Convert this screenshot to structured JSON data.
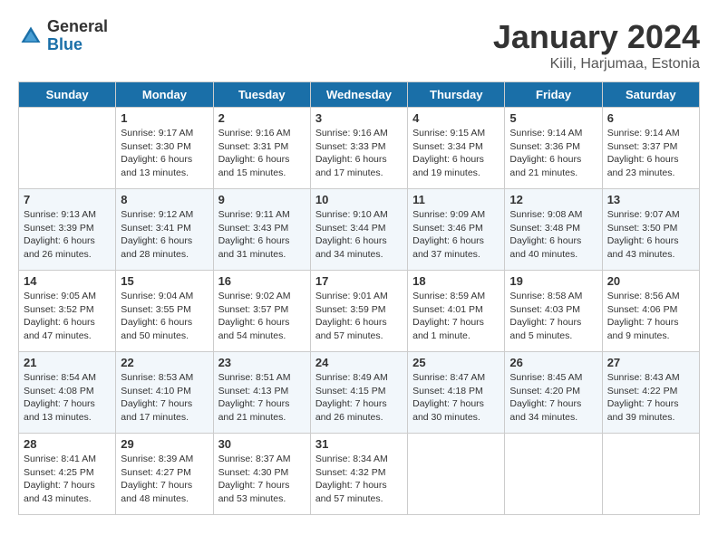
{
  "header": {
    "logo_general": "General",
    "logo_blue": "Blue",
    "title": "January 2024",
    "subtitle": "Kiili, Harjumaa, Estonia"
  },
  "days_of_week": [
    "Sunday",
    "Monday",
    "Tuesday",
    "Wednesday",
    "Thursday",
    "Friday",
    "Saturday"
  ],
  "weeks": [
    [
      {
        "date": "",
        "info": ""
      },
      {
        "date": "1",
        "info": "Sunrise: 9:17 AM\nSunset: 3:30 PM\nDaylight: 6 hours\nand 13 minutes."
      },
      {
        "date": "2",
        "info": "Sunrise: 9:16 AM\nSunset: 3:31 PM\nDaylight: 6 hours\nand 15 minutes."
      },
      {
        "date": "3",
        "info": "Sunrise: 9:16 AM\nSunset: 3:33 PM\nDaylight: 6 hours\nand 17 minutes."
      },
      {
        "date": "4",
        "info": "Sunrise: 9:15 AM\nSunset: 3:34 PM\nDaylight: 6 hours\nand 19 minutes."
      },
      {
        "date": "5",
        "info": "Sunrise: 9:14 AM\nSunset: 3:36 PM\nDaylight: 6 hours\nand 21 minutes."
      },
      {
        "date": "6",
        "info": "Sunrise: 9:14 AM\nSunset: 3:37 PM\nDaylight: 6 hours\nand 23 minutes."
      }
    ],
    [
      {
        "date": "7",
        "info": "Sunrise: 9:13 AM\nSunset: 3:39 PM\nDaylight: 6 hours\nand 26 minutes."
      },
      {
        "date": "8",
        "info": "Sunrise: 9:12 AM\nSunset: 3:41 PM\nDaylight: 6 hours\nand 28 minutes."
      },
      {
        "date": "9",
        "info": "Sunrise: 9:11 AM\nSunset: 3:43 PM\nDaylight: 6 hours\nand 31 minutes."
      },
      {
        "date": "10",
        "info": "Sunrise: 9:10 AM\nSunset: 3:44 PM\nDaylight: 6 hours\nand 34 minutes."
      },
      {
        "date": "11",
        "info": "Sunrise: 9:09 AM\nSunset: 3:46 PM\nDaylight: 6 hours\nand 37 minutes."
      },
      {
        "date": "12",
        "info": "Sunrise: 9:08 AM\nSunset: 3:48 PM\nDaylight: 6 hours\nand 40 minutes."
      },
      {
        "date": "13",
        "info": "Sunrise: 9:07 AM\nSunset: 3:50 PM\nDaylight: 6 hours\nand 43 minutes."
      }
    ],
    [
      {
        "date": "14",
        "info": "Sunrise: 9:05 AM\nSunset: 3:52 PM\nDaylight: 6 hours\nand 47 minutes."
      },
      {
        "date": "15",
        "info": "Sunrise: 9:04 AM\nSunset: 3:55 PM\nDaylight: 6 hours\nand 50 minutes."
      },
      {
        "date": "16",
        "info": "Sunrise: 9:02 AM\nSunset: 3:57 PM\nDaylight: 6 hours\nand 54 minutes."
      },
      {
        "date": "17",
        "info": "Sunrise: 9:01 AM\nSunset: 3:59 PM\nDaylight: 6 hours\nand 57 minutes."
      },
      {
        "date": "18",
        "info": "Sunrise: 8:59 AM\nSunset: 4:01 PM\nDaylight: 7 hours\nand 1 minute."
      },
      {
        "date": "19",
        "info": "Sunrise: 8:58 AM\nSunset: 4:03 PM\nDaylight: 7 hours\nand 5 minutes."
      },
      {
        "date": "20",
        "info": "Sunrise: 8:56 AM\nSunset: 4:06 PM\nDaylight: 7 hours\nand 9 minutes."
      }
    ],
    [
      {
        "date": "21",
        "info": "Sunrise: 8:54 AM\nSunset: 4:08 PM\nDaylight: 7 hours\nand 13 minutes."
      },
      {
        "date": "22",
        "info": "Sunrise: 8:53 AM\nSunset: 4:10 PM\nDaylight: 7 hours\nand 17 minutes."
      },
      {
        "date": "23",
        "info": "Sunrise: 8:51 AM\nSunset: 4:13 PM\nDaylight: 7 hours\nand 21 minutes."
      },
      {
        "date": "24",
        "info": "Sunrise: 8:49 AM\nSunset: 4:15 PM\nDaylight: 7 hours\nand 26 minutes."
      },
      {
        "date": "25",
        "info": "Sunrise: 8:47 AM\nSunset: 4:18 PM\nDaylight: 7 hours\nand 30 minutes."
      },
      {
        "date": "26",
        "info": "Sunrise: 8:45 AM\nSunset: 4:20 PM\nDaylight: 7 hours\nand 34 minutes."
      },
      {
        "date": "27",
        "info": "Sunrise: 8:43 AM\nSunset: 4:22 PM\nDaylight: 7 hours\nand 39 minutes."
      }
    ],
    [
      {
        "date": "28",
        "info": "Sunrise: 8:41 AM\nSunset: 4:25 PM\nDaylight: 7 hours\nand 43 minutes."
      },
      {
        "date": "29",
        "info": "Sunrise: 8:39 AM\nSunset: 4:27 PM\nDaylight: 7 hours\nand 48 minutes."
      },
      {
        "date": "30",
        "info": "Sunrise: 8:37 AM\nSunset: 4:30 PM\nDaylight: 7 hours\nand 53 minutes."
      },
      {
        "date": "31",
        "info": "Sunrise: 8:34 AM\nSunset: 4:32 PM\nDaylight: 7 hours\nand 57 minutes."
      },
      {
        "date": "",
        "info": ""
      },
      {
        "date": "",
        "info": ""
      },
      {
        "date": "",
        "info": ""
      }
    ]
  ]
}
